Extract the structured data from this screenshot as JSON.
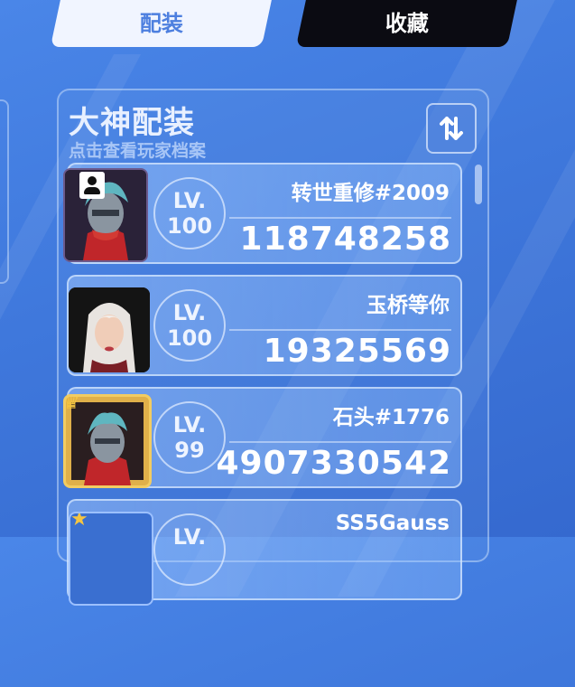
{
  "tabs": [
    {
      "label": "配装"
    },
    {
      "label": "收藏"
    }
  ],
  "panel": {
    "title": "大神配装",
    "subtitle": "点击查看玩家档案",
    "sort_icon": "sort-toggle-icon"
  },
  "players": [
    {
      "name": "转世重修#2009",
      "level_prefix": "LV.",
      "level": "100",
      "power": "118748258",
      "frame": "dark"
    },
    {
      "name": "玉桥等你",
      "level_prefix": "LV.",
      "level": "100",
      "power": "19325569",
      "frame": "none"
    },
    {
      "name": "石头#1776",
      "level_prefix": "LV.",
      "level": "99",
      "power": "4907330542",
      "frame": "gold"
    },
    {
      "name": "SS5Gauss",
      "level_prefix": "LV.",
      "level": "",
      "power": "",
      "frame": "star"
    }
  ]
}
